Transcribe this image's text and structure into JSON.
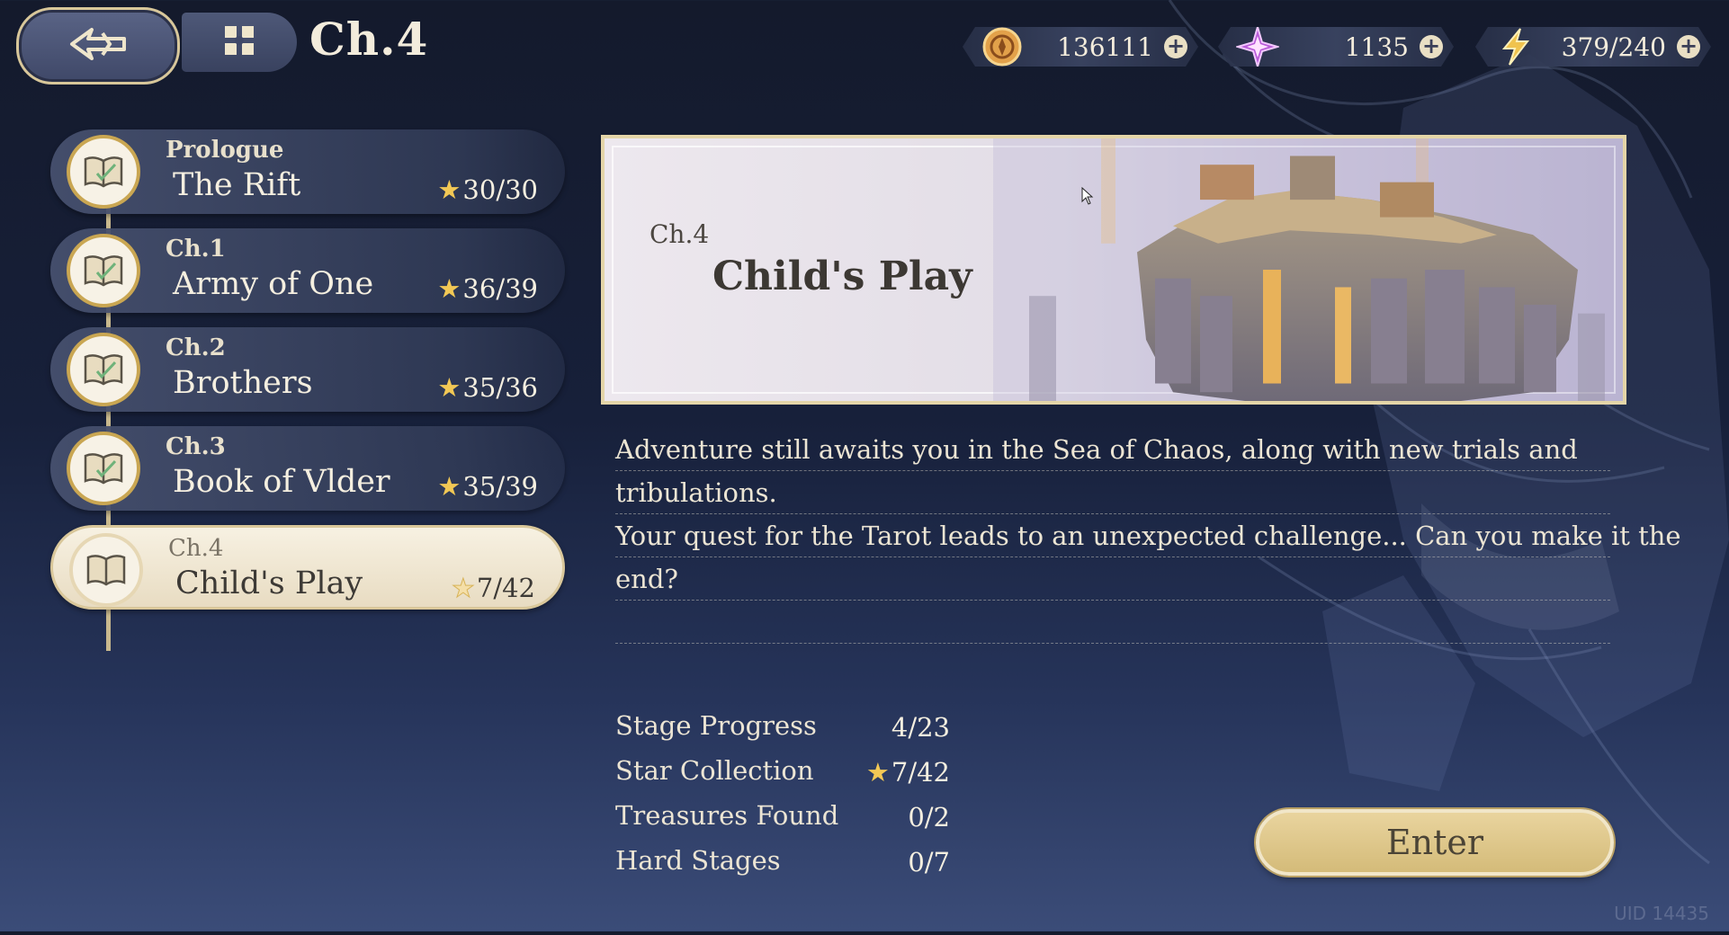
{
  "header": {
    "title": "Ch.4",
    "back_icon": "back-arrow-icon",
    "menu_icon": "grid-menu-icon"
  },
  "currencies": [
    {
      "name": "gold-coin",
      "value": "136111",
      "plus": "+"
    },
    {
      "name": "star-crystal",
      "value": "1135",
      "plus": "+"
    },
    {
      "name": "stamina",
      "value": "379/240",
      "plus": "+"
    }
  ],
  "chapters": [
    {
      "num": "Prologue",
      "name": "The Rift",
      "stars": "30/30"
    },
    {
      "num": "Ch.1",
      "name": "Army of One",
      "stars": "36/39"
    },
    {
      "num": "Ch.2",
      "name": "Brothers",
      "stars": "35/36"
    },
    {
      "num": "Ch.3",
      "name": "Book of Vlder",
      "stars": "35/39"
    },
    {
      "num": "Ch.4",
      "name": "Child's Play",
      "stars": "7/42"
    }
  ],
  "star_glyph": "★",
  "banner": {
    "chapter": "Ch.4",
    "title": "Child's Play"
  },
  "description": {
    "line1": "Adventure still awaits you in the Sea of Chaos, along with new trials and",
    "line2": "tribulations.",
    "line3": "Your quest for the Tarot leads to an unexpected challenge... Can you make it the",
    "line4": "end?",
    "line5": ""
  },
  "stats": [
    {
      "label": "Stage Progress",
      "value": "4/23"
    },
    {
      "label": "Star Collection",
      "value": "7/42"
    },
    {
      "label": "Treasures Found",
      "value": "0/2"
    },
    {
      "label": "Hard Stages",
      "value": "0/7"
    }
  ],
  "enter_label": "Enter",
  "uid": "UID 14435",
  "colors": {
    "accent_gold": "#d9c79a",
    "star": "#f2c855",
    "panel": "#46506e"
  }
}
